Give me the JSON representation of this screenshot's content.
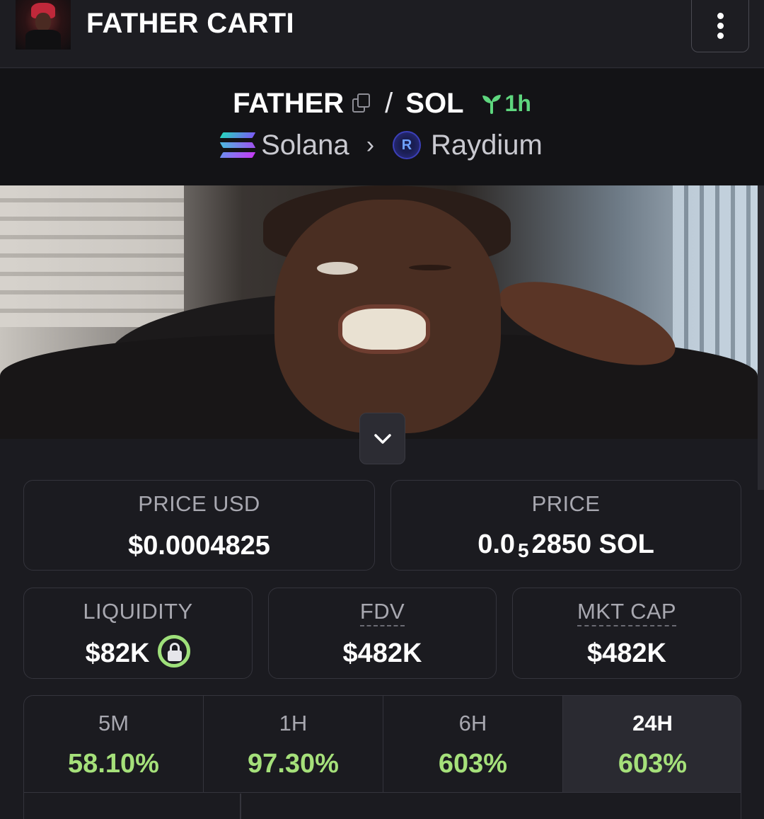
{
  "header": {
    "title": "FATHER CARTI"
  },
  "pair": {
    "base": "FATHER",
    "separator": "/",
    "quote": "SOL",
    "age": "1h",
    "chain": "Solana",
    "dex": "Raydium",
    "dex_icon_letter": "R"
  },
  "stats": {
    "price_usd_label": "PRICE USD",
    "price_usd": "$0.0004825",
    "price_label": "PRICE",
    "price_sol_prefix": "0.0",
    "price_sol_zeros": "5",
    "price_sol_suffix": "2850 SOL",
    "liquidity_label": "LIQUIDITY",
    "liquidity": "$82K",
    "fdv_label": "FDV",
    "fdv": "$482K",
    "mkt_cap_label": "MKT CAP",
    "mkt_cap": "$482K"
  },
  "changes": [
    {
      "period": "5M",
      "value": "58.10%"
    },
    {
      "period": "1H",
      "value": "97.30%"
    },
    {
      "period": "6H",
      "value": "603%"
    },
    {
      "period": "24H",
      "value": "603%"
    }
  ],
  "colors": {
    "background": "#1b1b20",
    "positive": "#a5e07a",
    "age_green": "#5ed67e",
    "border": "#34343c"
  },
  "icons": {
    "menu": "vertical-dots-icon",
    "copy": "copy-icon",
    "age": "sprout-icon",
    "chain": "solana-icon",
    "dex": "raydium-icon",
    "expand": "chevron-down-icon",
    "liquidity_lock": "lock-icon"
  }
}
